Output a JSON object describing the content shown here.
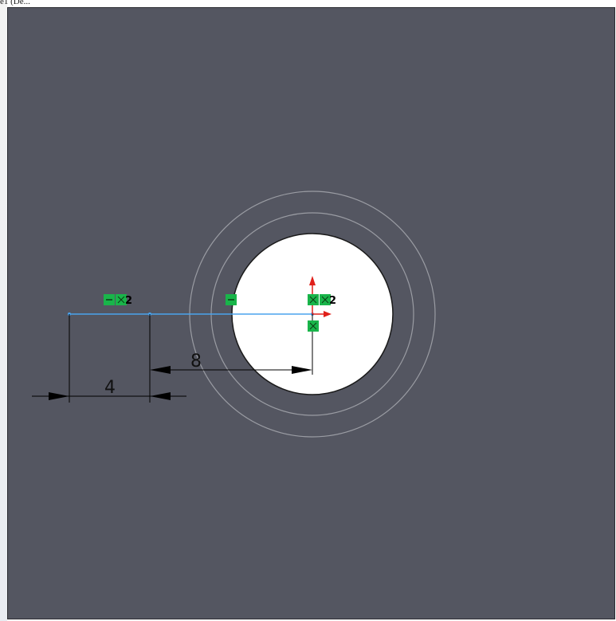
{
  "window": {
    "title_fragment": "e1 (De..."
  },
  "sketch": {
    "dimensions": {
      "length_label": "4",
      "offset_label": "8"
    },
    "relations": {
      "left_badge_count": "2",
      "center_badge_count": "2"
    }
  },
  "colors": {
    "background": "#545661",
    "sketch_line": "#4aa3ee",
    "relation_badge": "#19b54a",
    "axis_red": "#e0201a",
    "circle_fill": "#ffffff",
    "outline_gray": "#9a9ca3"
  },
  "icons": [
    "horizontal-relation-icon",
    "coincident-relation-icon",
    "origin-axis-icon"
  ]
}
